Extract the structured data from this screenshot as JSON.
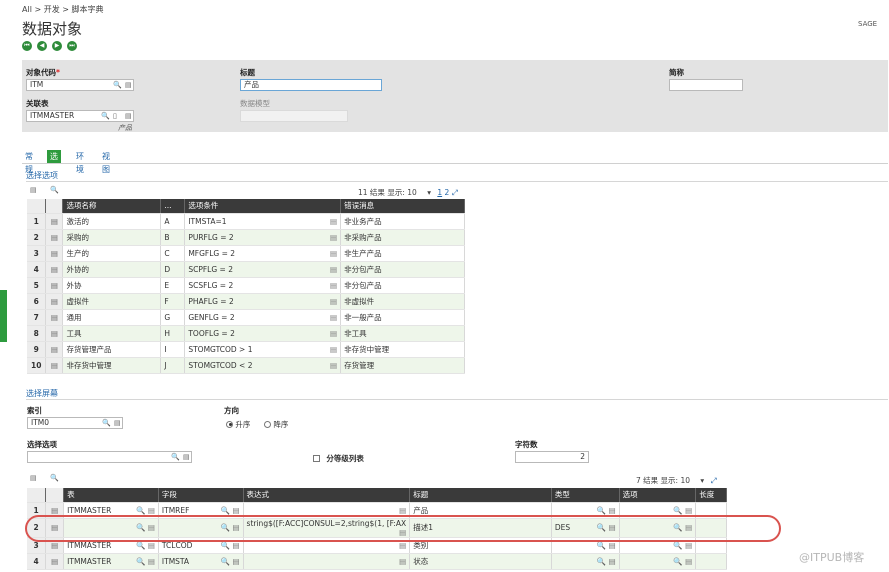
{
  "breadcrumb": {
    "all": "All >",
    "dev": "开发 >",
    "dict": "脚本字典"
  },
  "page_title": "数据对象",
  "sage_label": "SAGE",
  "nav_buttons": [
    "⏮",
    "◀",
    "▶",
    "⏭"
  ],
  "header": {
    "object_code_label": "对象代码",
    "required_mark": "*",
    "object_code_value": "ITM",
    "title_label": "标题",
    "title_value": "产品",
    "short_label": "简称",
    "short_value": "",
    "related_table_label": "关联表",
    "related_table_value": "ITMMASTER",
    "related_table_desc": "产品",
    "data_model_label": "数据模型",
    "data_model_value": ""
  },
  "tabs": [
    "常规",
    "选择",
    "环境",
    "视图"
  ],
  "active_tab": "选择",
  "selection_options": {
    "section_title": "选择选项",
    "pager": {
      "results": "11 结果",
      "display_label": "显示:",
      "display_value": "10",
      "page1": "1",
      "page2": "2"
    },
    "columns": [
      "选项名称",
      "...",
      "选项条件",
      "错误消息"
    ],
    "rows": [
      {
        "num": "1",
        "name": "激活的",
        "code": "A",
        "cond": "ITMSTA=1",
        "msg": "非业务产品"
      },
      {
        "num": "2",
        "name": "采购的",
        "code": "B",
        "cond": "PURFLG = 2",
        "msg": "非采购产品"
      },
      {
        "num": "3",
        "name": "生产的",
        "code": "C",
        "cond": "MFGFLG = 2",
        "msg": "非生产产品"
      },
      {
        "num": "4",
        "name": "外协的",
        "code": "D",
        "cond": "SCPFLG = 2",
        "msg": "非分包产品"
      },
      {
        "num": "5",
        "name": "外协",
        "code": "E",
        "cond": "SCSFLG = 2",
        "msg": "非分包产品"
      },
      {
        "num": "6",
        "name": "虚拟件",
        "code": "F",
        "cond": "PHAFLG = 2",
        "msg": "非虚拟件"
      },
      {
        "num": "7",
        "name": "通用",
        "code": "G",
        "cond": "GENFLG = 2",
        "msg": "非一般产品"
      },
      {
        "num": "8",
        "name": "工具",
        "code": "H",
        "cond": "TOOFLG = 2",
        "msg": "非工具"
      },
      {
        "num": "9",
        "name": "存货管理产品",
        "code": "I",
        "cond": "STOMGTCOD > 1",
        "msg": "非存货中管理"
      },
      {
        "num": "10",
        "name": "非存货中管理",
        "code": "J",
        "cond": "STOMGTCOD < 2",
        "msg": "存货管理"
      }
    ]
  },
  "selection_screen": {
    "section_title": "选择屏幕",
    "index_label": "索引",
    "index_value": "ITM0",
    "direction_label": "方向",
    "asc_label": "升序",
    "desc_label": "降序",
    "direction_selected": "升序",
    "sel_option_label": "选择选项",
    "sel_option_value": "",
    "grouped_label": "分等级列表",
    "chars_label": "字符数",
    "chars_value": "2",
    "pager": {
      "results": "7 结果",
      "display_label": "显示:",
      "display_value": "10"
    },
    "columns": [
      "表",
      "字段",
      "表达式",
      "标题",
      "类型",
      "选项",
      "长度"
    ],
    "rows": [
      {
        "num": "1",
        "table": "ITMMASTER",
        "field": "ITMREF",
        "expr": "",
        "title": "产品",
        "type": "",
        "option": "",
        "length": ""
      },
      {
        "num": "2",
        "table": "",
        "field": "",
        "expr": "string$([F:ACC]CONSUL=2,string$(1, [F:AX",
        "title": "描述1",
        "type": "DES",
        "option": "",
        "length": ""
      },
      {
        "num": "3",
        "table": "ITMMASTER",
        "field": "TCLCOD",
        "expr": "",
        "title": "类别",
        "type": "",
        "option": "",
        "length": ""
      },
      {
        "num": "4",
        "table": "ITMMASTER",
        "field": "ITMSTA",
        "expr": "",
        "title": "状态",
        "type": "",
        "option": "",
        "length": ""
      }
    ]
  },
  "watermark": "@ITPUB博客",
  "colors": {
    "accent_green": "#2e9b3e",
    "link_blue": "#2366a8",
    "highlight_red": "#d9534f",
    "header_dark": "#3a3a3a"
  }
}
